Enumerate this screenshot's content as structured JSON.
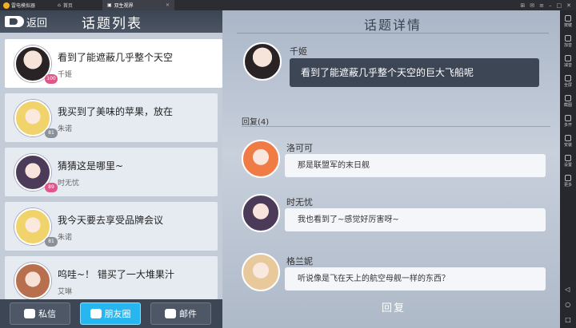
{
  "emulator": {
    "app_name": "雷电模拟器",
    "tabs": [
      {
        "label": "首页"
      },
      {
        "label": "双生视界"
      }
    ],
    "sidebar": [
      "按键",
      "加音",
      "减音",
      "全屏",
      "截图",
      "多开",
      "安装",
      "设置",
      "更多"
    ]
  },
  "left_panel": {
    "back_label": "返回",
    "title": "话题列表",
    "topics": [
      {
        "text": "看到了能遮蔽几乎整个天空",
        "author": "千姬",
        "level": "100",
        "avatar": "girl1"
      },
      {
        "text": "我买到了美味的苹果，放在",
        "author": "朱诺",
        "level": "81",
        "avatar": "girl2"
      },
      {
        "text": "猜猜这是哪里~",
        "author": "时无忧",
        "level": "89",
        "avatar": "girl3"
      },
      {
        "text": "我今天要去享受品牌会议",
        "author": "朱诺",
        "level": "81",
        "avatar": "girl2"
      },
      {
        "text": "呜哇~！   错买了一大堆果汁",
        "author": "艾琳",
        "level": "",
        "avatar": "girl4"
      }
    ],
    "buttons": {
      "message": "私信",
      "moments": "朋友圈",
      "mail": "邮件"
    }
  },
  "detail": {
    "title": "话题详情",
    "post": {
      "author": "千姬",
      "text": "看到了能遮蔽几乎整个天空的巨大飞船呢"
    },
    "reply_label": "回复(4)",
    "replies": [
      {
        "author": "洛可可",
        "text": "那是联盟军的末日舰",
        "avatar": "girl5"
      },
      {
        "author": "时无忧",
        "text": "我也看到了~感觉好厉害呀~",
        "avatar": "girl3"
      },
      {
        "author": "格兰妮",
        "text": "听说像是飞在天上的航空母舰一样的东西？",
        "avatar": "girl6"
      }
    ],
    "reply_button": "回复"
  }
}
